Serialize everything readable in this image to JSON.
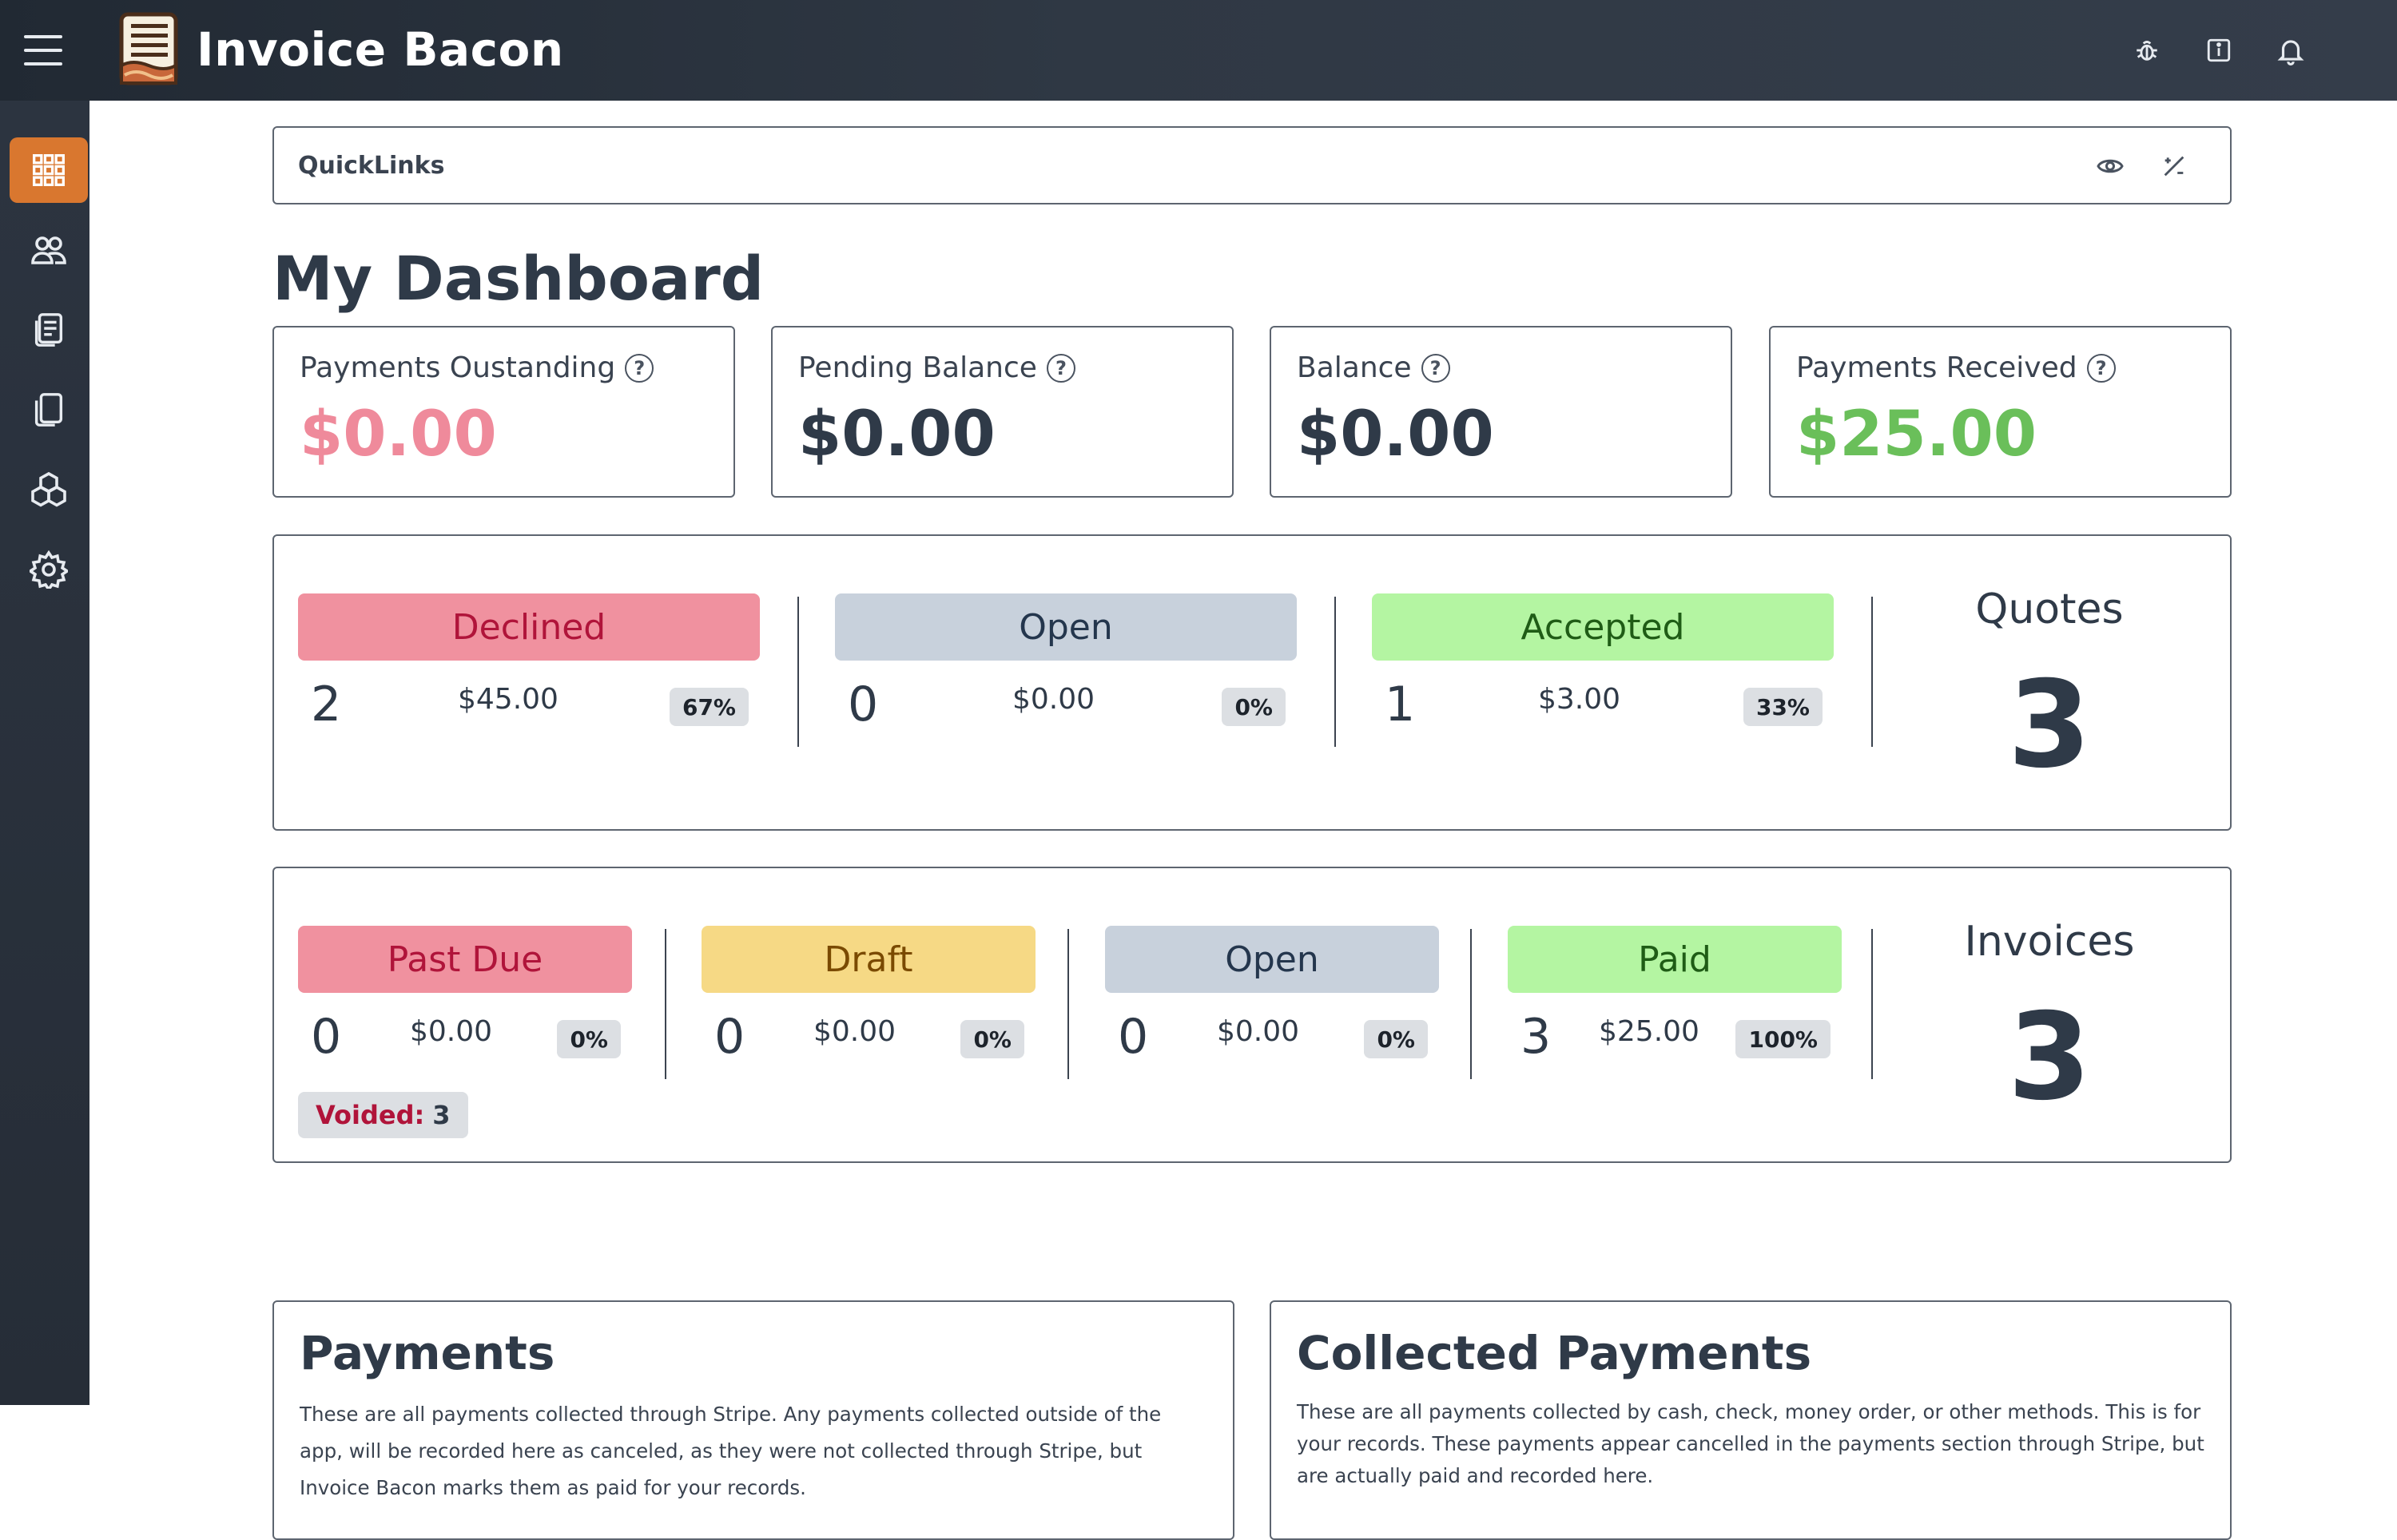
{
  "app": {
    "title": "Invoice Bacon"
  },
  "quicklinks": {
    "title": "QuickLinks"
  },
  "page": {
    "title": "My Dashboard"
  },
  "stats": [
    {
      "label": "Payments Oustanding",
      "value": "$0.00",
      "color": "#ef8a9b"
    },
    {
      "label": "Pending Balance",
      "value": "$0.00",
      "color": "#2f3a48"
    },
    {
      "label": "Balance",
      "value": "$0.00",
      "color": "#2f3a48"
    },
    {
      "label": "Payments Received",
      "value": "$25.00",
      "color": "#6abf5a"
    }
  ],
  "quotes": {
    "label": "Quotes",
    "total": "3",
    "statuses": [
      {
        "label": "Declined",
        "count": "2",
        "amount": "$45.00",
        "percent": "67%",
        "bg": "#f0919f",
        "fg": "#b0143a"
      },
      {
        "label": "Open",
        "count": "0",
        "amount": "$0.00",
        "percent": "0%",
        "bg": "#c8d1dc",
        "fg": "#24364d"
      },
      {
        "label": "Accepted",
        "count": "1",
        "amount": "$3.00",
        "percent": "33%",
        "bg": "#b4f5a2",
        "fg": "#1f5c16"
      }
    ]
  },
  "invoices": {
    "label": "Invoices",
    "total": "3",
    "voided_label": "Voided:",
    "voided_count": "3",
    "statuses": [
      {
        "label": "Past Due",
        "count": "0",
        "amount": "$0.00",
        "percent": "0%",
        "bg": "#f0919f",
        "fg": "#b0143a"
      },
      {
        "label": "Draft",
        "count": "0",
        "amount": "$0.00",
        "percent": "0%",
        "bg": "#f6d985",
        "fg": "#7a4a00"
      },
      {
        "label": "Open",
        "count": "0",
        "amount": "$0.00",
        "percent": "0%",
        "bg": "#c8d1dc",
        "fg": "#24364d"
      },
      {
        "label": "Paid",
        "count": "3",
        "amount": "$25.00",
        "percent": "100%",
        "bg": "#b4f5a2",
        "fg": "#1f5c16"
      }
    ]
  },
  "payments": {
    "title": "Payments",
    "text": "These are all payments collected through Stripe. Any payments collected outside of the app, will be recorded here as canceled, as they were not collected through Stripe, but Invoice Bacon marks them as paid for your records."
  },
  "collected": {
    "title": "Collected Payments",
    "text": "These are all payments collected by cash, check, money order, or other methods. This is for your records. These payments appear cancelled in the payments section through Stripe, but are actually paid and recorded here."
  },
  "colors": {
    "accent": "#d9772f",
    "header": "#2f3844",
    "sidebar": "#2a323d"
  },
  "icons": {
    "header": [
      "bug-icon",
      "info-icon",
      "bell-icon"
    ],
    "sidebar": [
      "dashboard-grid-icon",
      "clients-icon",
      "quotes-icon",
      "invoices-icon",
      "products-icon",
      "settings-icon"
    ],
    "quicklinks": [
      "eye-icon",
      "edit-icon"
    ]
  }
}
